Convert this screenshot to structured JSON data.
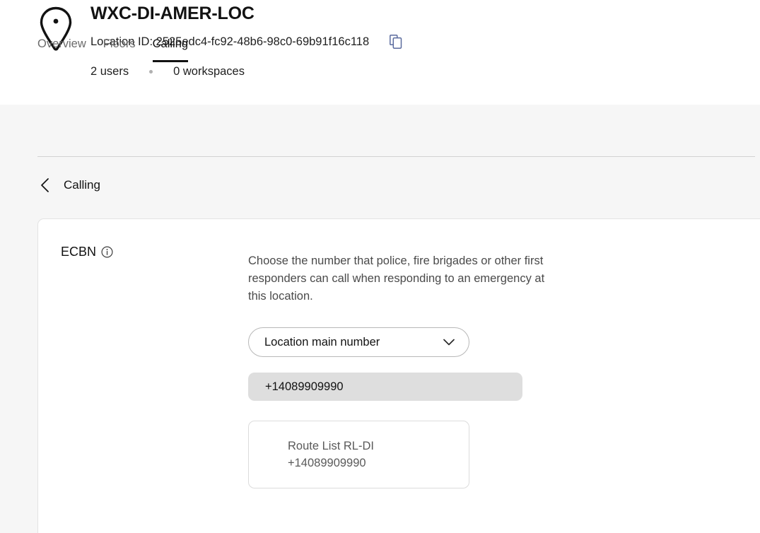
{
  "header": {
    "pin_icon": "location-pin-icon",
    "title": "WXC-DI-AMER-LOC",
    "location_id_label": "Location ID: 2525edc4-fc92-48b6-98c0-69b91f16c118",
    "copy_icon": "copy-icon",
    "users_count": "2 users",
    "workspaces_count": "0 workspaces"
  },
  "tabs": [
    {
      "label": "Overview",
      "active": false
    },
    {
      "label": "Floors",
      "active": false
    },
    {
      "label": "Calling",
      "active": true
    }
  ],
  "back_nav": {
    "chevron_icon": "chevron-left-icon",
    "label": "Calling"
  },
  "ecbn_section": {
    "title": "ECBN",
    "info_icon": "info-circle-icon",
    "description": "Choose the number that police, fire brigades or other first responders can call when responding to an emergency at this location.",
    "select": {
      "value": "Location main number",
      "chevron_icon": "chevron-down-icon"
    },
    "number_pill": "+14089909990",
    "route_card": {
      "line1": "Route List RL-DI",
      "line2": "+14089909990"
    }
  },
  "colors": {
    "page_background": "#ffffff",
    "grey_background": "#f6f6f6",
    "active_tab": "#121212",
    "inactive_tab": "#6b6b6b",
    "pill_background": "#dedede",
    "copy_icon": "#5b6b9e"
  }
}
